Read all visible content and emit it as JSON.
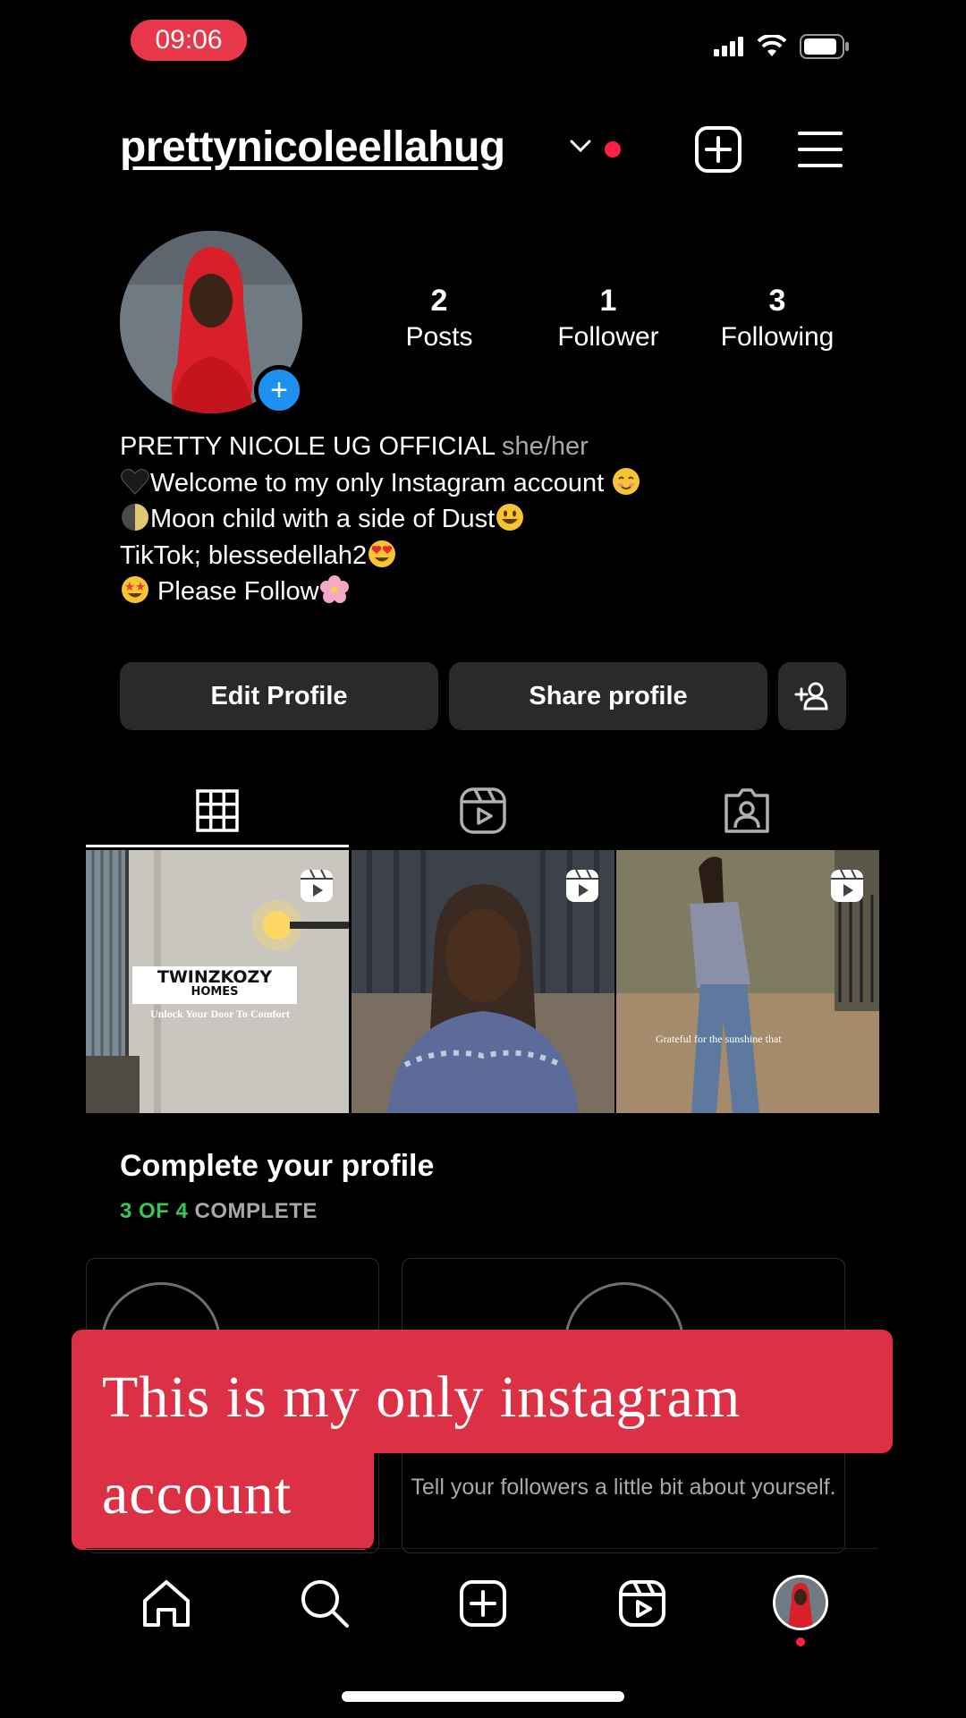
{
  "status_bar": {
    "time": "09:06"
  },
  "header": {
    "username": "prettynicoleellahug"
  },
  "profile": {
    "stats": [
      {
        "value": "2",
        "label": "Posts"
      },
      {
        "value": "1",
        "label": "Follower"
      },
      {
        "value": "3",
        "label": "Following"
      }
    ],
    "display_name": "PRETTY NICOLE UG OFFICIAL",
    "pronouns": "she/her",
    "bio_lines": [
      "Welcome to my only Instagram account ",
      "Moon child with a side of Dust",
      "TikTok; blessedellah2",
      " Please Follow"
    ]
  },
  "actions": {
    "edit_profile": "Edit Profile",
    "share_profile": "Share profile"
  },
  "grid": {
    "post1": {
      "brand": "TWINZKOZY",
      "brand_sub": "HOMES",
      "tagline": "Unlock Your Door To Comfort"
    },
    "post3": {
      "caption": "Grateful for the sunshine that"
    }
  },
  "complete_profile": {
    "title": "Complete your profile",
    "progress_done": "3 OF 4",
    "progress_word": "COMPLETE",
    "bio_card_text": "Tell your followers a little bit about yourself."
  },
  "caption_overlay": {
    "text": "This is my only instagram account"
  },
  "colors": {
    "accent_red": "#dc3045",
    "progress_green": "#34c759",
    "button_bg": "#2a2a2a",
    "add_blue": "#1e90f0"
  },
  "icons": [
    "signal-icon",
    "wifi-icon",
    "battery-icon",
    "chevron-down-icon",
    "new-post-icon",
    "menu-icon",
    "add-person-icon",
    "grid-icon",
    "reels-icon",
    "tagged-icon",
    "home-icon",
    "search-icon",
    "create-icon"
  ]
}
